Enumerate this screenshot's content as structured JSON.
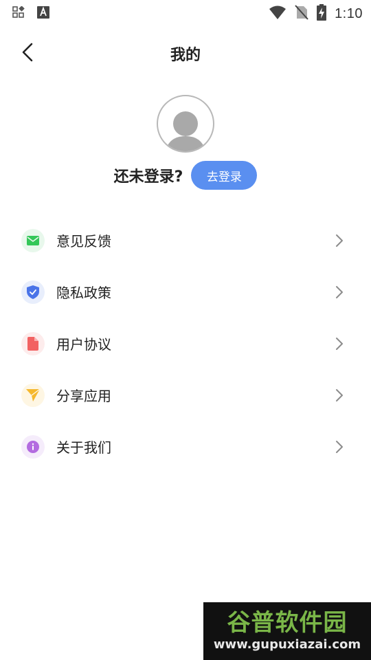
{
  "status_bar": {
    "time": "1:10",
    "icons_left": [
      "grid-icon",
      "font-a-icon"
    ],
    "icons_right": [
      "wifi-icon",
      "no-sim-icon",
      "battery-charging-icon"
    ]
  },
  "header": {
    "title": "我的"
  },
  "profile": {
    "login_prompt": "还未登录?",
    "login_button": "去登录"
  },
  "menu": {
    "items": [
      {
        "label": "意见反馈",
        "icon": "mail-icon",
        "color": "#34c759",
        "bg": "#e8f8ec"
      },
      {
        "label": "隐私政策",
        "icon": "shield-icon",
        "color": "#4a74e8",
        "bg": "#e8eefc"
      },
      {
        "label": "用户协议",
        "icon": "document-icon",
        "color": "#f26262",
        "bg": "#fdecec"
      },
      {
        "label": "分享应用",
        "icon": "send-icon",
        "color": "#f5b82e",
        "bg": "#fef6e3"
      },
      {
        "label": "关于我们",
        "icon": "info-icon",
        "color": "#b36be0",
        "bg": "#f5ecfb"
      }
    ]
  },
  "watermark": {
    "name": "谷普软件园",
    "url": "www.gupuxiazai.com"
  },
  "colors": {
    "accent": "#5a8ff0",
    "text": "#222222",
    "chevron": "#8c8c8c"
  }
}
